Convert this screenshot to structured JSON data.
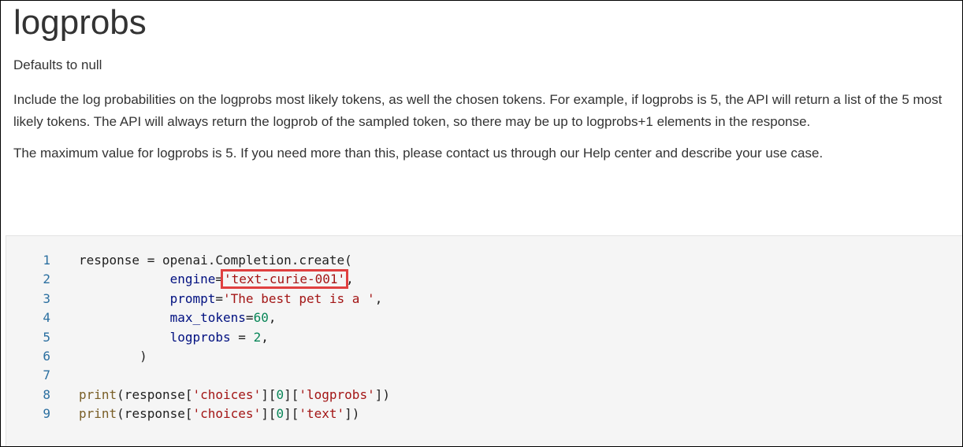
{
  "heading": "logprobs",
  "default_text": "Defaults to null",
  "paragraphs": [
    "Include the log probabilities on the logprobs most likely tokens, as well the chosen tokens. For example, if logprobs is 5, the API will return a list of the 5 most likely tokens. The API will always return the logprob of the sampled token, so there may be up to logprobs+1 elements in the response.",
    "The maximum value for logprobs is 5. If you need more than this, please contact us through our Help center and describe your use case."
  ],
  "code": {
    "line_numbers": [
      "1",
      "2",
      "3",
      "4",
      "5",
      "6",
      "7",
      "8",
      "9"
    ],
    "l1": {
      "var": "response = openai.",
      "fn": "Completion.create("
    },
    "l2": {
      "indent": "            ",
      "param": "engine",
      "eq": "=",
      "str": "'text-curie-001'",
      "comma": ","
    },
    "l3": {
      "indent": "            ",
      "param": "prompt",
      "eq": "=",
      "str": "'The best pet is a '",
      "comma": ","
    },
    "l4": {
      "indent": "            ",
      "param": "max_tokens",
      "eq": "=",
      "num": "60",
      "comma": ","
    },
    "l5": {
      "indent": "            ",
      "param": "logprobs",
      "eq": " = ",
      "num": "2",
      "comma": ","
    },
    "l6": {
      "text": "        )"
    },
    "l7": {
      "text": ""
    },
    "l8": {
      "fn": "print",
      "a": "(response[",
      "s1": "'choices'",
      "b": "][",
      "n": "0",
      "c": "][",
      "s2": "'logprobs'",
      "d": "])"
    },
    "l9": {
      "fn": "print",
      "a": "(response[",
      "s1": "'choices'",
      "b": "][",
      "n": "0",
      "c": "][",
      "s2": "'text'",
      "d": "])"
    }
  },
  "colors": {
    "highlight_border": "#e04040",
    "string": "#a31515",
    "number": "#098658",
    "function": "#795e26",
    "parameter": "#001080",
    "line_number": "#2b6fa0",
    "code_background": "#f5f5f5"
  }
}
